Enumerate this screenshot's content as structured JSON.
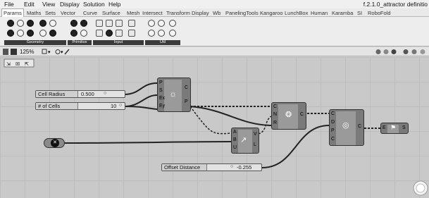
{
  "menu": {
    "items": [
      "File",
      "Edit",
      "View",
      "Display",
      "Solution",
      "Help"
    ],
    "filename": "f.2.1.0_attractor definitio"
  },
  "tabs": [
    "Params",
    "Maths",
    "Sets",
    "Vector",
    "Curve",
    "Surface",
    "Mesh",
    "Intersect",
    "Transform",
    "Display",
    "Wb",
    "PanelingTools",
    "Kangaroo",
    "LunchBox",
    "Human",
    "Karamba",
    "SI",
    "RoboFold"
  ],
  "ribbon": {
    "panels": [
      "Geometry",
      "Primitive",
      "Input",
      "Util"
    ]
  },
  "toolbar": {
    "zoom": "125%"
  },
  "sliders": {
    "cell_radius": {
      "label": "Cell Radius",
      "value": "0.500"
    },
    "num_cells": {
      "label": "# of Cells",
      "value": "10"
    },
    "offset": {
      "label": "Offset Distance",
      "value": "-0.255"
    }
  },
  "components": {
    "hexgrid": {
      "inputs": [
        "P",
        "S",
        "Ex",
        "Ey"
      ],
      "outputs": [
        "C",
        "P"
      ]
    },
    "closest": {
      "inputs": [
        "C",
        "N",
        "R"
      ],
      "outputs": [
        "C"
      ]
    },
    "vector": {
      "inputs": [
        "A",
        "B",
        "U"
      ],
      "outputs": [
        "V",
        "L"
      ]
    },
    "offset": {
      "inputs": [
        "C",
        "D",
        "P",
        "C"
      ],
      "outputs": [
        "C"
      ]
    },
    "extrude": {
      "inputs": [
        "E"
      ],
      "outputs": [
        "S"
      ]
    }
  }
}
